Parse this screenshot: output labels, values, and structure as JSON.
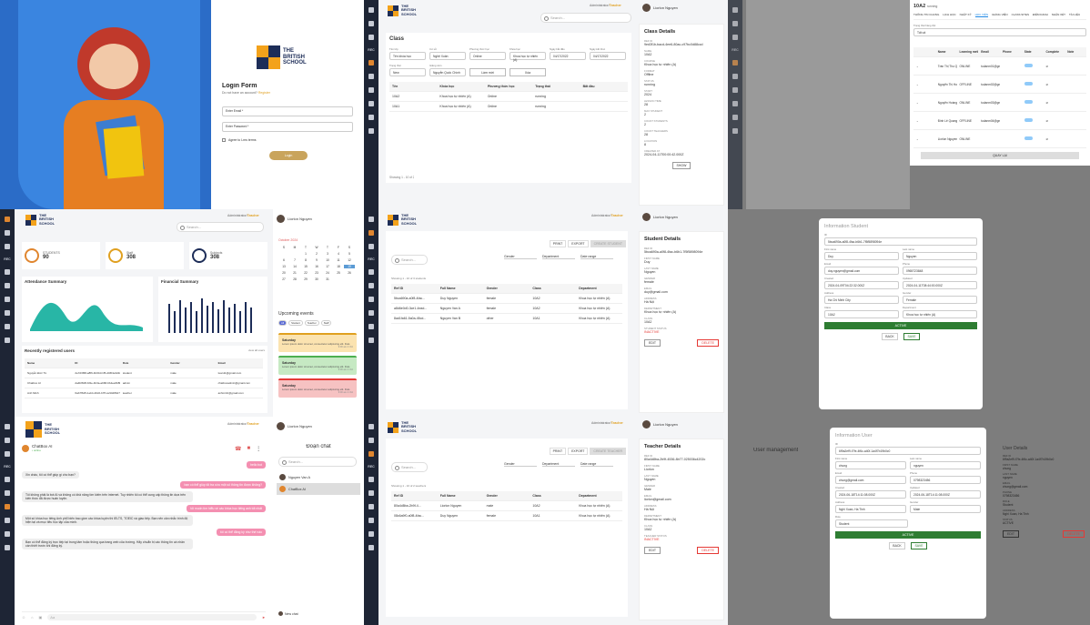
{
  "brand": {
    "line1": "THE",
    "line2": "BRITISH",
    "line3": "SCHOOL",
    "colors": [
      "#f3a21b",
      "#1d2d58",
      "#1d2d58",
      "#f3a21b"
    ]
  },
  "admin_label": {
    "prefix": "Administrator/",
    "name": "Teacher"
  },
  "user": {
    "name": "Liorlon Nguyen"
  },
  "search_placeholder": "Search...",
  "login": {
    "title": "Login Form",
    "subtitle": "Do not have an account?",
    "register": "Register",
    "email_placeholder": "Enter Email *",
    "password_placeholder": "Enter Password *",
    "agree": "Agree to Lms terms",
    "button": "Login"
  },
  "classes": {
    "title": "Class",
    "filters": [
      {
        "label": "Tên lớp",
        "value": "Tên khóa học"
      },
      {
        "label": "Cơ sở",
        "value": "Nghệ Xuân"
      },
      {
        "label": "Phương thức học",
        "value": "Online"
      },
      {
        "label": "Khóa học",
        "value": "Khoa học tự nhiên (A)"
      },
      {
        "label": "Ngày bắt đầu",
        "value": "04/17/2022"
      },
      {
        "label": "Ngày kết thúc",
        "value": "04/17/2022"
      }
    ],
    "status_label": "Trạng thái",
    "status_value": "New",
    "teacher_label": "Giảng viên",
    "teacher_value": "Nguyễn Quốc Chính",
    "reload": "Làm mới",
    "delete": "Xóa",
    "columns": [
      "Tên",
      "Khóa học",
      "Phương thức học",
      "Trạng thái",
      "Bắt đầu"
    ],
    "rows": [
      [
        "10A2",
        "Khoa học tự nhiên (A)",
        "Online",
        "running",
        ""
      ],
      [
        "10A1",
        "Khoa học tự nhiên (A)",
        "Online",
        "running",
        ""
      ]
    ],
    "footer": "Showing 1 - 10 of 2"
  },
  "class_details": {
    "title": "Class Details",
    "fields": [
      {
        "label": "REF ID",
        "value": "9ed3f1b-bacd-4ee6-80ac-c97bc0d88ccd"
      },
      {
        "label": "NAME",
        "value": "10A2"
      },
      {
        "label": "COURSE",
        "value": "Khoa học tự nhiên (A)"
      },
      {
        "label": "FORMAT",
        "value": "Offline"
      },
      {
        "label": "STATUS",
        "value": "running"
      },
      {
        "label": "START",
        "value": "2024"
      },
      {
        "label": "LESSON TIME",
        "value": "28"
      },
      {
        "label": "MAX STUDENT",
        "value": "2"
      },
      {
        "label": "COUNT STUDENTS",
        "value": "2"
      },
      {
        "label": "COUNT TEACHERS",
        "value": "28"
      },
      {
        "label": "LOCATION",
        "value": "8"
      },
      {
        "label": "CREATED AT",
        "value": "2024-04-11T00:00:42.000Z"
      }
    ],
    "show": "SHOW"
  },
  "class_members": {
    "class_name": "10A2",
    "class_status": "running",
    "tabs": [
      "THÔNG TIN CHUNG",
      "LỊCH HỌC",
      "NHẬT KÝ",
      "HỌC VIÊN",
      "GIẢNG VIÊN",
      "CLASS SITES",
      "ĐIỂM DANH",
      "NHẬN XÉT",
      "TÀI LIỆU"
    ],
    "type_label": "Trạng thái hàng đợi",
    "type_value": "Tất cả",
    "columns": [
      "Name",
      "Learning method",
      "Email",
      "Phone",
      "State",
      "Complete",
      "Note"
    ],
    "rows": [
      {
        "name": "Trần Thị Thu Quý",
        "method": "ONLINE",
        "email": "tudanm01@gmail.com"
      },
      {
        "name": "Nguyễn Thị Hương",
        "method": "OFFLINE",
        "email": "tudanm02@gmail.com"
      },
      {
        "name": "Nguyễn Hoàng Sơn",
        "method": "ONLINE",
        "email": "tudanm03@gmail.com"
      },
      {
        "name": "Đinh Lê Quang Huy",
        "method": "OFFLINE",
        "email": "tudanm04@gmail.com"
      },
      {
        "name": "Liorlon Nguyen",
        "method": "ONLINE",
        "email": ""
      }
    ],
    "back": "QUAY LẠI"
  },
  "dashboard": {
    "stats": [
      {
        "label": "STUDENTS",
        "value": "90",
        "color": "#e0862f"
      },
      {
        "label": "Staff",
        "value": "308",
        "color": "#e0a020"
      },
      {
        "label": "Subjects",
        "value": "308",
        "color": "#1d2d58"
      }
    ],
    "attendance_title": "Attendance Summary",
    "financial_title": "Financial Summary",
    "recent_title": "Recently registered users",
    "view_all": "view all users",
    "columns": [
      "Name",
      "ID",
      "Role",
      "Gender",
      "Email"
    ],
    "rows": [
      [
        "Nguyễn Đức Tú",
        "2e7d3f68-a8f6-4b00-b1f5-d46f4e3d3a1",
        "student",
        "male",
        "tuan11@gmail.com"
      ],
      [
        "Chatbox AI",
        "da4f2608-bf4e-4b3a-ab68-bb4ee6b8b6c8",
        "admin",
        "male",
        "chatboxadmin@gmail.com"
      ],
      [
        "Anh Minh",
        "6ab7f625-1eb4-40c0-b7ff-ce9428b27740",
        "teacher",
        "male",
        "anhminh@gmail.com"
      ]
    ]
  },
  "calendar": {
    "month": "October 2024",
    "days": [
      "S",
      "M",
      "T",
      "W",
      "T",
      "F",
      "S"
    ],
    "cells": [
      "",
      "",
      "1",
      "2",
      "3",
      "4",
      "5",
      "6",
      "7",
      "8",
      "9",
      "10",
      "11",
      "12",
      "13",
      "14",
      "15",
      "16",
      "17",
      "18",
      "19",
      "20",
      "21",
      "22",
      "23",
      "24",
      "25",
      "26",
      "27",
      "28",
      "29",
      "30",
      "31",
      "",
      ""
    ],
    "selected": "19",
    "events_title": "Upcoming events",
    "filters": [
      "All",
      "Student",
      "Teacher",
      "Staff"
    ],
    "events": [
      {
        "title": "Saturday",
        "text": "Lorem ipsum dolor sit amet, consectetur adipiscing elit. Duis",
        "time": "9:00 am 4 Oct",
        "color": "#fbe3b0",
        "border": "#e0a020"
      },
      {
        "title": "Saturday",
        "text": "Lorem ipsum dolor sit amet, consectetur adipiscing elit. Duis",
        "time": "9:00 am 4 Oct",
        "color": "#c6e9c3",
        "border": "#4caf50"
      },
      {
        "title": "Saturday",
        "text": "Lorem ipsum dolor sit amet, consectetur adipiscing elit. Duis",
        "time": "9:00 am 4 Oct",
        "color": "#f6c2c2",
        "border": "#e53935"
      }
    ]
  },
  "students": {
    "actions": [
      "PRINT",
      "EXPORT",
      "CREATE STUDENT"
    ],
    "filter_labels": [
      "Gender",
      "Department",
      "Date range"
    ],
    "columns": [
      "Ref ID",
      "Full Name",
      "Gender",
      "Class",
      "Department"
    ],
    "rows": [
      [
        "5bca690a-a0f8-4fac...",
        "Duy Nguyen",
        "female",
        "10A2",
        "Khoa học tự nhiên (A)"
      ],
      [
        "a8d6e0d0-3ce1-4ead...",
        "Nguyen Van A",
        "female",
        "10A2",
        "Khoa học tự nhiên (A)"
      ],
      [
        "8ad1fa61-5a0a-45cd...",
        "Nguyen Van B",
        "other",
        "10A1",
        "Khoa học tự nhiên (A)"
      ]
    ],
    "footer": "Showing 1 - 10 of 3 students"
  },
  "student_details": {
    "title": "Student Details",
    "fields": [
      {
        "label": "REF ID",
        "value": "5bca690a-a0f8-4fac-b6b1-7f5f5898094e"
      },
      {
        "label": "FIRST NAME",
        "value": "Duy"
      },
      {
        "label": "LAST NAME",
        "value": "Nguyen"
      },
      {
        "label": "GENDER",
        "value": "female"
      },
      {
        "label": "EMAIL",
        "value": "duy@gmail.com"
      },
      {
        "label": "ADDRESS",
        "value": "Hà Nội"
      },
      {
        "label": "DEPARTMENT",
        "value": "Khoa học tự nhiên (A)"
      },
      {
        "label": "CLASS",
        "value": "10A2"
      },
      {
        "label": "STUDENT STATUS",
        "value": "INACTIVE"
      }
    ],
    "edit": "EDIT",
    "delete": "DELETE"
  },
  "student_modal": {
    "title": "Information Student",
    "fields": [
      {
        "label": "ID",
        "value": "5bca690a-a0f8-4fac-b6b1-7f5f5898094e"
      },
      {
        "label": "First name",
        "value": "Duy"
      },
      {
        "label": "Last name",
        "value": "Nguyen"
      },
      {
        "label": "Email",
        "value": "duy.nguyen@gmail.com"
      },
      {
        "label": "Phone",
        "value": "0965723848"
      },
      {
        "label": "Created",
        "value": "2024-04-09T04:22:32.000Z"
      },
      {
        "label": "Updated",
        "value": "2024-04-11T08:44:00.000Z"
      },
      {
        "label": "Address",
        "value": "Ha Chi Minh City"
      },
      {
        "label": "Gender",
        "value": "Female"
      },
      {
        "label": "Class",
        "value": "10A2"
      },
      {
        "label": "Department",
        "value": "Khoa học tự nhiên (A)"
      }
    ],
    "status": "ACTIVE",
    "back": "BACK",
    "save": "SAVE"
  },
  "chat": {
    "contact": "ChatBox AI",
    "status": "• online",
    "messages": [
      {
        "side": "right",
        "text": "hello bot"
      },
      {
        "side": "left",
        "text": "Xin chào, tôi có thể giúp gì cho bạn?"
      },
      {
        "side": "right",
        "text": "bạn có thể giúp tôi tra cứu một số thông tin được không?"
      },
      {
        "side": "left",
        "text": "Tôi không phải là bot AI và không có khả năng tìm kiếm trên internet. Tuy nhiên tôi có thể cung cấp thông tin dựa trên kiến thức đã được huấn luyện."
      },
      {
        "side": "right",
        "text": "tôi muốn tìm hiểu về các khóa học tiếng anh tốt nhất"
      },
      {
        "side": "left",
        "text": "Một số khóa học tiếng Anh phổ biến bao gồm các khóa luyện thi IELTS, TOEIC và giao tiếp. Bạn nên cân nhắc trình độ hiện tại và mục tiêu học tập của mình."
      },
      {
        "side": "right",
        "text": "tôi có thể đăng ký như thế nào"
      },
      {
        "side": "left",
        "text": "Bạn có thể đăng ký trực tiếp tại trung tâm hoặc thông qua trang web của trường. Hãy chuẩn bị các thông tin cá nhân cần thiết trước khi đăng ký."
      }
    ],
    "input_placeholder": "Aa"
  },
  "chat_list": {
    "title": "Đoạn chat",
    "search_placeholder": "Search...",
    "items": [
      "Nguyen Van A",
      "ChatBox AI"
    ],
    "new_chat": "New chat"
  },
  "teachers": {
    "actions": [
      "PRINT",
      "EXPORT",
      "CREATE TEACHER"
    ],
    "filter_labels": [
      "Gender",
      "Department",
      "Date range"
    ],
    "columns": [
      "Ref ID",
      "Full Name",
      "Gender",
      "Class",
      "Department"
    ],
    "rows": [
      [
        "80a4d8ba-2b9f-4...",
        "Liorlon Nguyen",
        "male",
        "10A2",
        "Khoa học tự nhiên (A)"
      ],
      [
        "08c6a9f0-a0f8-4fac...",
        "Duy Nguyen",
        "female",
        "10A1",
        "Khoa học tự nhiên (A)"
      ]
    ],
    "footer": "Showing 1 - 10 of 2 teachers"
  },
  "teacher_details": {
    "title": "Teacher Details",
    "fields": [
      {
        "label": "REF ID",
        "value": "80a4d8ba-2b9f-4536-8b77-025036c4202c"
      },
      {
        "label": "FIRST NAME",
        "value": "Liorlon"
      },
      {
        "label": "LAST NAME",
        "value": "Nguyen"
      },
      {
        "label": "GENDER",
        "value": "Male"
      },
      {
        "label": "EMAIL",
        "value": "liorlon@gmail.com"
      },
      {
        "label": "ADDRESS",
        "value": "Hà Nội"
      },
      {
        "label": "DEPARTMENT",
        "value": "Khoa học tự nhiên (A)"
      },
      {
        "label": "CLASS",
        "value": "10A2"
      },
      {
        "label": "TEACHER STATUS",
        "value": "INACTIVE"
      }
    ],
    "edit": "EDIT",
    "delete": "DELETE"
  },
  "user_mgmt": {
    "title": "User management",
    "modal_title": "Information User",
    "fields": [
      {
        "label": "ID",
        "value": "6f9a2ef9-f7fe-4f6c-a40f-1a4f7b19b0c0"
      },
      {
        "label": "First name",
        "value": "chung"
      },
      {
        "label": "Last name",
        "value": "nguyen"
      },
      {
        "label": "Email",
        "value": "chung@gmail.com"
      },
      {
        "label": "Phone",
        "value": "0798323456"
      },
      {
        "label": "Created",
        "value": "2024-06-18T14:11:08.000Z"
      },
      {
        "label": "Updated",
        "value": "2024-06-18T14:11:08.000Z"
      },
      {
        "label": "Address",
        "value": "Nghi Xuan, Ha Tinh"
      },
      {
        "label": "Gender",
        "value": "Male"
      },
      {
        "label": "Role",
        "value": "Student"
      }
    ],
    "status": "ACTIVE",
    "back": "BACK",
    "save": "SAVE",
    "details_title": "User Details",
    "details": [
      {
        "label": "REF ID",
        "value": "6f9a2ef9-f7fe-4f6c-a40f-1a4f7b19b0c0"
      },
      {
        "label": "FIRST NAME",
        "value": "chung"
      },
      {
        "label": "LAST NAME",
        "value": "nguyen"
      },
      {
        "label": "EMAIL",
        "value": "chung@gmail.com"
      },
      {
        "label": "PHONE",
        "value": "0798323456"
      },
      {
        "label": "ROLE",
        "value": "Student"
      },
      {
        "label": "ADDRESS",
        "value": "Nghi Xuan, Ha Tinh"
      },
      {
        "label": "STATUS",
        "value": "ACTIVE"
      }
    ],
    "edit": "EDIT",
    "delete": "DELETE"
  }
}
